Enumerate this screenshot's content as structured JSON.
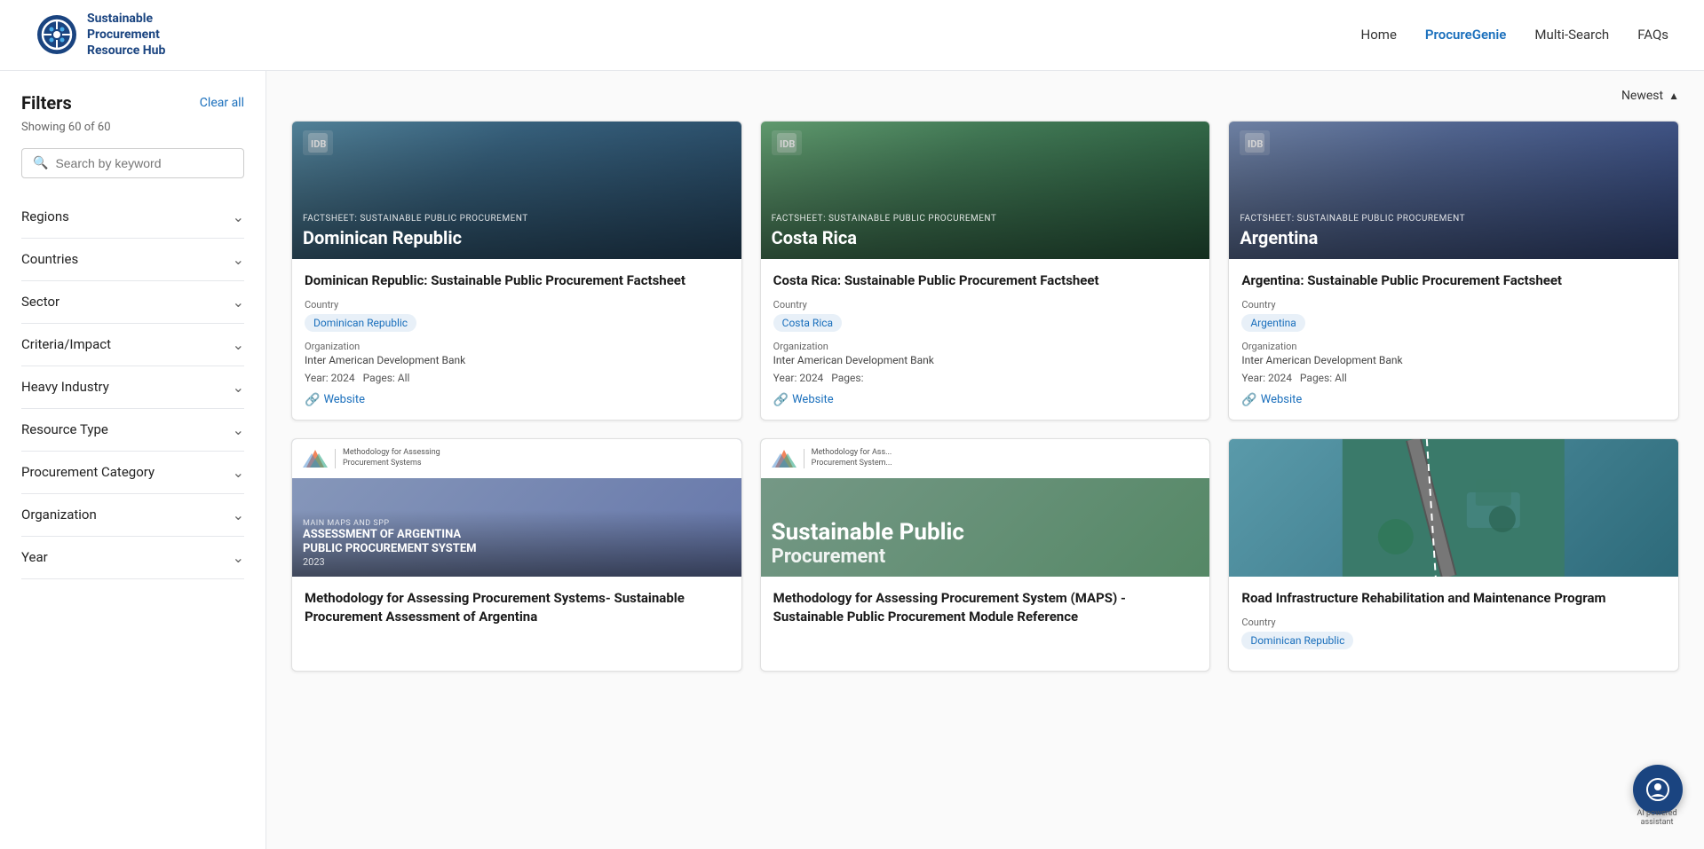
{
  "header": {
    "logo_line1": "Sustainable",
    "logo_line2": "Procurement",
    "logo_line3": "Resource Hub",
    "nav": [
      {
        "label": "Home",
        "active": false
      },
      {
        "label": "ProcureGenie",
        "active": true
      },
      {
        "label": "Multi-Search",
        "active": false
      },
      {
        "label": "FAQs",
        "active": false
      }
    ]
  },
  "sidebar": {
    "title": "Filters",
    "clear_all": "Clear all",
    "showing": "Showing 60 of 60",
    "search_placeholder": "Search by keyword",
    "filters": [
      {
        "label": "Regions"
      },
      {
        "label": "Countries"
      },
      {
        "label": "Sector"
      },
      {
        "label": "Criteria/Impact"
      },
      {
        "label": "Heavy Industry"
      },
      {
        "label": "Resource Type"
      },
      {
        "label": "Procurement Category"
      },
      {
        "label": "Organization"
      },
      {
        "label": "Year"
      }
    ]
  },
  "content": {
    "sort_label": "Newest",
    "cards": [
      {
        "id": "card1",
        "type": "idb",
        "image_label": "FACTSHEET: SUSTAINABLE PUBLIC PROCUREMENT",
        "image_title": "Dominican Republic",
        "title": "Dominican Republic: Sustainable Public Procurement Factsheet",
        "meta_type": "Country",
        "tag": "Dominican Republic",
        "org_label": "Organization",
        "org": "Inter American Development Bank",
        "year": "2024",
        "pages": "All",
        "has_website": true,
        "website_label": "Website",
        "bg": "bg-dominican"
      },
      {
        "id": "card2",
        "type": "idb",
        "image_label": "FACTSHEET: SUSTAINABLE PUBLIC PROCUREMENT",
        "image_title": "Costa Rica",
        "title": "Costa Rica: Sustainable Public Procurement Factsheet",
        "meta_type": "Country",
        "tag": "Costa Rica",
        "org_label": "Organization",
        "org": "Inter American Development Bank",
        "year": "2024",
        "pages": "",
        "has_website": true,
        "website_label": "Website",
        "bg": "bg-costarica"
      },
      {
        "id": "card3",
        "type": "idb",
        "image_label": "FACTSHEET: SUSTAINABLE PUBLIC PROCUREMENT",
        "image_title": "Argentina",
        "title": "Argentina: Sustainable Public Procurement Factsheet",
        "meta_type": "Country",
        "tag": "Argentina",
        "org_label": "Organization",
        "org": "Inter American Development Bank",
        "year": "2024",
        "pages": "All",
        "has_website": true,
        "website_label": "Website",
        "bg": "bg-argentina"
      },
      {
        "id": "card4",
        "type": "maps",
        "image_subtitle": "MAIN MAPS AND SPP",
        "image_body1": "ASSESSMENT OF ARGENTINA",
        "image_body2": "PUBLIC PROCUREMENT SYSTEM",
        "image_year": "2023",
        "title": "Methodology for Assessing Procurement Systems- Sustainable Procurement Assessment of Argentina",
        "meta_type": "",
        "tag": "",
        "org_label": "",
        "org": "",
        "year": "",
        "pages": "",
        "has_website": false,
        "website_label": "",
        "bg": "bg-maps1"
      },
      {
        "id": "card5",
        "type": "maps",
        "image_subtitle": "Sustainable Public",
        "image_body1": "Procurement",
        "image_body2": "",
        "image_year": "",
        "title": "Methodology for Assessing Procurement System (MAPS) - Sustainable Public Procurement Module Reference",
        "meta_type": "",
        "tag": "",
        "org_label": "",
        "org": "",
        "year": "",
        "pages": "",
        "has_website": false,
        "website_label": "",
        "bg": "bg-maps2"
      },
      {
        "id": "card6",
        "type": "road",
        "image_title": "",
        "title": "Road Infrastructure Rehabilitation and Maintenance Program",
        "meta_type": "Country",
        "tag": "Dominican Republic",
        "org_label": "",
        "org": "",
        "year": "",
        "pages": "",
        "has_website": false,
        "website_label": "",
        "bg": "bg-road"
      }
    ]
  },
  "ai_assistant": {
    "label": "AI powered assistant"
  }
}
